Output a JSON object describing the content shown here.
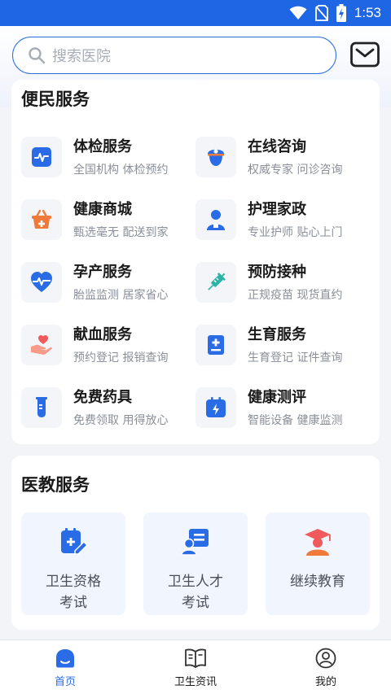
{
  "status_bar": {
    "time": "1:53"
  },
  "search": {
    "placeholder": "搜索医院"
  },
  "convenience": {
    "title": "便民服务",
    "items": [
      {
        "name": "体检服务",
        "desc": "全国机构 体检预约",
        "icon": "pulse-monitor-icon"
      },
      {
        "name": "在线咨询",
        "desc": "权威专家 问诊咨询",
        "icon": "nurse-icon"
      },
      {
        "name": "健康商城",
        "desc": "甄选毫无 配送到家",
        "icon": "shopping-basket-icon"
      },
      {
        "name": "护理家政",
        "desc": "专业护师 贴心上门",
        "icon": "caregiver-icon"
      },
      {
        "name": "孕产服务",
        "desc": "胎监监测 居家省心",
        "icon": "heartbeat-icon"
      },
      {
        "name": "预防接种",
        "desc": "正规疫苗 现货直约",
        "icon": "syringe-icon"
      },
      {
        "name": "献血服务",
        "desc": "预约登记 报销查询",
        "icon": "hand-heart-icon"
      },
      {
        "name": "生育服务",
        "desc": "生育登记 证件查询",
        "icon": "medical-book-icon"
      },
      {
        "name": "免费药具",
        "desc": "免费领取 用得放心",
        "icon": "test-tube-icon"
      },
      {
        "name": "健康测评",
        "desc": "智能设备 健康监测",
        "icon": "calendar-bolt-icon"
      }
    ]
  },
  "education": {
    "title": "医教服务",
    "items": [
      {
        "line1": "卫生资格",
        "line2": "考试",
        "icon": "exam-edit-icon"
      },
      {
        "line1": "卫生人才",
        "line2": "考试",
        "icon": "talent-card-icon"
      },
      {
        "line1": "继续教育",
        "line2": "",
        "icon": "graduate-cap-icon"
      }
    ]
  },
  "bottom_nav": {
    "items": [
      {
        "label": "首页",
        "icon": "home-icon",
        "active": true
      },
      {
        "label": "卫生资讯",
        "icon": "book-icon",
        "active": false
      },
      {
        "label": "我的",
        "icon": "profile-icon",
        "active": false
      }
    ]
  },
  "colors": {
    "primary": "#2a6ce6",
    "accent": "#f07a3a",
    "danger": "#f05a5a"
  }
}
